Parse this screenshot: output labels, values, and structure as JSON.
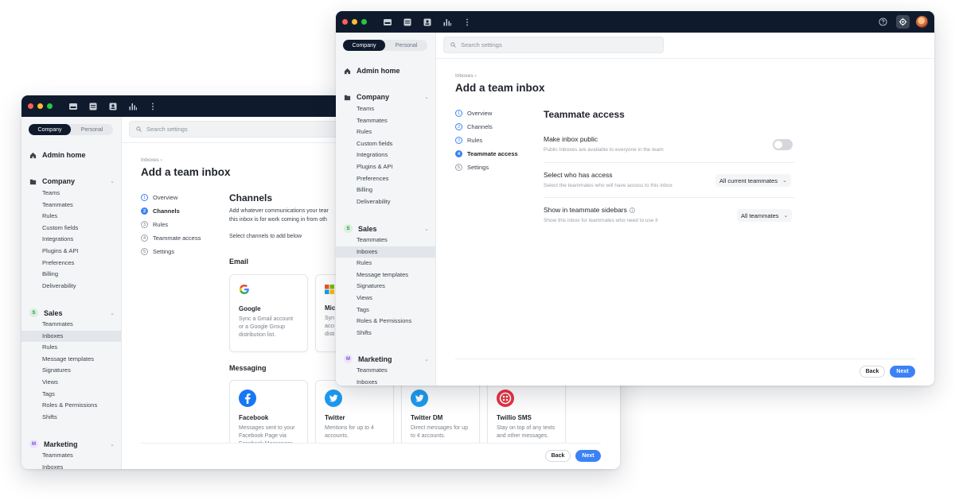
{
  "colors": {
    "titlebar": "#0f1b2d",
    "accent": "#3b82f6",
    "red_dot": "#ff5f57",
    "yellow_dot": "#febc2e",
    "green_dot": "#28c840"
  },
  "toolbar_icons": [
    "inbox-icon",
    "calendar-icon",
    "contacts-icon",
    "analytics-icon",
    "more-icon"
  ],
  "back_window": {
    "segment": {
      "company": "Company",
      "personal": "Personal"
    },
    "search_placeholder": "Search settings",
    "admin_home": "Admin home",
    "company": {
      "label": "Company",
      "items": [
        "Teams",
        "Teammates",
        "Rules",
        "Custom fields",
        "Integrations",
        "Plugins & API",
        "Preferences",
        "Billing",
        "Deliverability"
      ]
    },
    "sales": {
      "badge": "S",
      "label": "Sales",
      "items": [
        "Teammates",
        "Inboxes",
        "Rules",
        "Message templates",
        "Signatures",
        "Views",
        "Tags",
        "Roles & Permissions",
        "Shifts"
      ],
      "selected": "Inboxes"
    },
    "marketing": {
      "badge": "M",
      "label": "Marketing",
      "items": [
        "Teammates",
        "Inboxes"
      ]
    },
    "breadcrumb": "Inboxes ›",
    "title": "Add a team inbox",
    "steps": [
      {
        "num": "1",
        "label": "Overview"
      },
      {
        "num": "2",
        "label": "Channels"
      },
      {
        "num": "3",
        "label": "Rules"
      },
      {
        "num": "4",
        "label": "Teammate access"
      },
      {
        "num": "5",
        "label": "Settings"
      }
    ],
    "section_title": "Channels",
    "section_desc_1": "Add whatever communications your tear",
    "section_desc_2": "this inbox is for work coming in from oth",
    "select_prompt": "Select channels to add below",
    "email_heading": "Email",
    "email_cards": [
      {
        "icon": "google-icon",
        "title": "Google",
        "desc": "Sync a Gmail account or a Google Group distribution list."
      },
      {
        "icon": "microsoft-icon",
        "title": "Mic",
        "desc": "Sync acco distr"
      }
    ],
    "messaging_heading": "Messaging",
    "messaging_cards": [
      {
        "icon": "facebook-icon",
        "title": "Facebook",
        "desc": "Messages sent to your Facebook Page via Facebook Messenger."
      },
      {
        "icon": "twitter-icon",
        "title": "Twitter",
        "desc": "Mentions for up to 4 accounts."
      },
      {
        "icon": "twitter-dm-icon",
        "title": "Twitter DM",
        "desc": "Direct messages for up to 4 accounts."
      },
      {
        "icon": "twilio-icon",
        "title": "Twillio SMS",
        "desc": "Stay on top of any texts and other messages."
      }
    ],
    "back_label": "Back",
    "next_label": "Next"
  },
  "front_window": {
    "segment": {
      "company": "Company",
      "personal": "Personal"
    },
    "search_placeholder": "Search settings",
    "admin_home": "Admin home",
    "company": {
      "label": "Company",
      "items": [
        "Teams",
        "Teammates",
        "Rules",
        "Custom fields",
        "Integrations",
        "Plugins & API",
        "Preferences",
        "Billing",
        "Deliverability"
      ]
    },
    "sales": {
      "badge": "S",
      "label": "Sales",
      "items": [
        "Teammates",
        "Inboxes",
        "Rules",
        "Message templates",
        "Signatures",
        "Views",
        "Tags",
        "Roles & Permissions",
        "Shifts"
      ],
      "selected": "Inboxes"
    },
    "marketing": {
      "badge": "M",
      "label": "Marketing",
      "items": [
        "Teammates",
        "Inboxes"
      ]
    },
    "breadcrumb": "Inboxes ›",
    "title": "Add a team inbox",
    "steps": [
      {
        "num": "1",
        "label": "Overview"
      },
      {
        "num": "2",
        "label": "Channels"
      },
      {
        "num": "3",
        "label": "Rules"
      },
      {
        "num": "4",
        "label": "Teammate access"
      },
      {
        "num": "5",
        "label": "Settings"
      }
    ],
    "section_title": "Teammate access",
    "rows": {
      "public": {
        "label": "Make inbox public",
        "sub": "Public Inboxes are available to everyone in the team",
        "on": false
      },
      "access": {
        "label": "Select who has access",
        "sub": "Select the teammates who will have access to this inbox",
        "value": "All current teammates"
      },
      "sidebars": {
        "label": "Show in teammate sidebars",
        "sub": "Show this inbox for teammates who need to use it",
        "value": "All teammates"
      }
    },
    "back_label": "Back",
    "next_label": "Next"
  }
}
